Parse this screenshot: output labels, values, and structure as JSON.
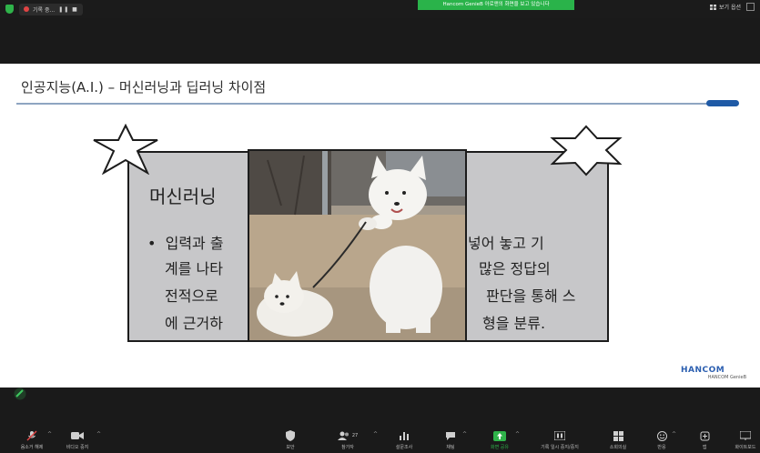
{
  "topbar": {
    "recording_label": "기록 중...",
    "recording_controls": "❚❚  ■",
    "share_banner": "Hancom GenieB 아로앤의 화면을 보고 있습니다",
    "view_label": "보기 옵션"
  },
  "slide": {
    "title": "인공지능(A.I.) – 머신러닝과 딥러닝 차이점",
    "heading": "머신러닝",
    "bullet_mark": "•",
    "left_lines": [
      "입력과 출",
      "계를 나타",
      "전적으로",
      "에 근거하"
    ],
    "right_lines": [
      "넣어 놓고 기",
      "많은 정답의",
      "판단을 통해 스",
      "형을 분류."
    ],
    "logo_text": "HANCOM",
    "logo_sub": "HANCOM GenieB"
  },
  "toolbar": {
    "items": [
      {
        "label": "음소거 해제",
        "icon": "muted-mic-icon"
      },
      {
        "label": "비디오 중지",
        "icon": "video-camera-icon"
      },
      {
        "label": "보안",
        "icon": "shield-icon"
      },
      {
        "label": "참가자",
        "icon": "participants-icon",
        "count": "27"
      },
      {
        "label": "설문조사",
        "icon": "poll-icon"
      },
      {
        "label": "채팅",
        "icon": "chat-icon"
      },
      {
        "label": "화면 공유",
        "icon": "share-screen-icon"
      },
      {
        "label": "기록 일시 중지/중지",
        "icon": "pause-record-icon"
      },
      {
        "label": "소회의실",
        "icon": "breakout-rooms-icon"
      },
      {
        "label": "반응",
        "icon": "reactions-icon"
      },
      {
        "label": "앱",
        "icon": "apps-icon"
      },
      {
        "label": "화이트보드",
        "icon": "whiteboard-icon"
      }
    ]
  },
  "colors": {
    "share_banner_green": "#2ab34a",
    "title_accent_blue": "#1f5aa6",
    "box_gray": "#c7c7c9"
  }
}
